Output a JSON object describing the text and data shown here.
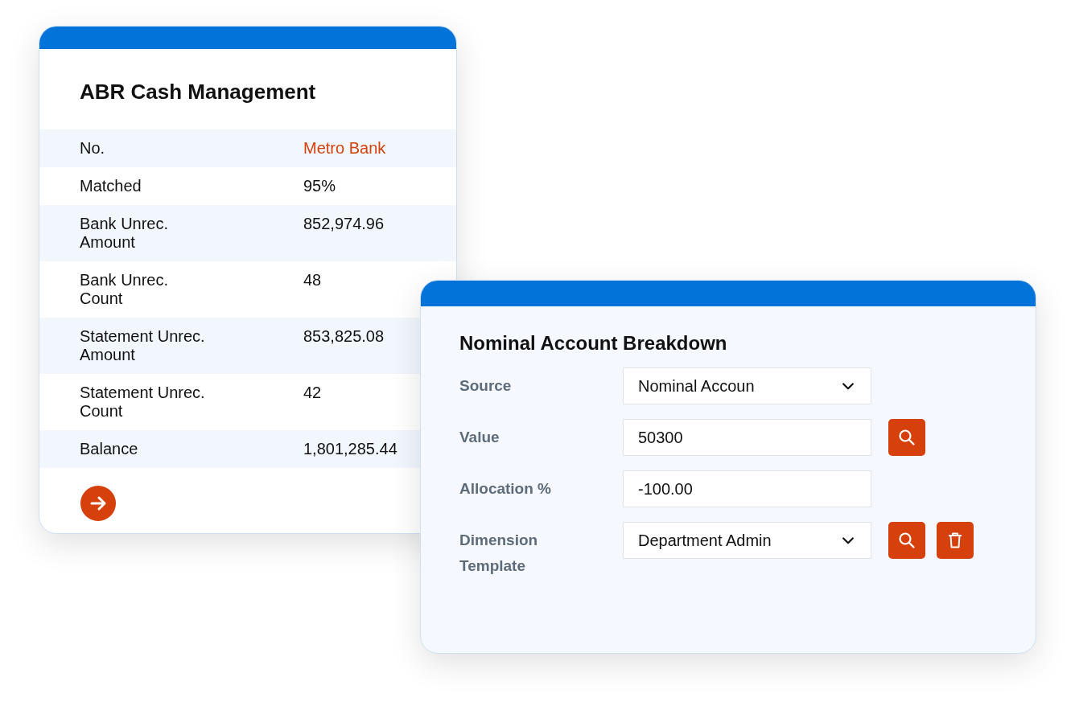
{
  "cash_card": {
    "title": "ABR Cash Management",
    "rows": [
      {
        "label": "No.",
        "value": "Metro Bank",
        "kind": "link"
      },
      {
        "label": "Matched",
        "value": "95%",
        "kind": "text"
      },
      {
        "label": "Bank Unrec. Amount",
        "value": "852,974.96",
        "kind": "text"
      },
      {
        "label": "Bank Unrec. Count",
        "value": "48",
        "kind": "text"
      },
      {
        "label": "Statement Unrec. Amount",
        "value": "853,825.08",
        "kind": "text"
      },
      {
        "label": "Statement Unrec. Count",
        "value": "42",
        "kind": "text"
      },
      {
        "label": "Balance",
        "value": "1,801,285.44",
        "kind": "text"
      }
    ]
  },
  "breakdown_card": {
    "title": "Nominal Account Breakdown",
    "fields": [
      {
        "label": "Source",
        "kind": "dropdown",
        "value": "Nominal Accoun"
      },
      {
        "label": "Value",
        "kind": "input",
        "value": "50300",
        "search_button": true
      },
      {
        "label": "Allocation %",
        "kind": "input",
        "value": "-100.00"
      },
      {
        "label": "Dimension Template",
        "kind": "dropdown",
        "value": "Department Admin",
        "search_button": true,
        "delete_button": true
      }
    ]
  }
}
